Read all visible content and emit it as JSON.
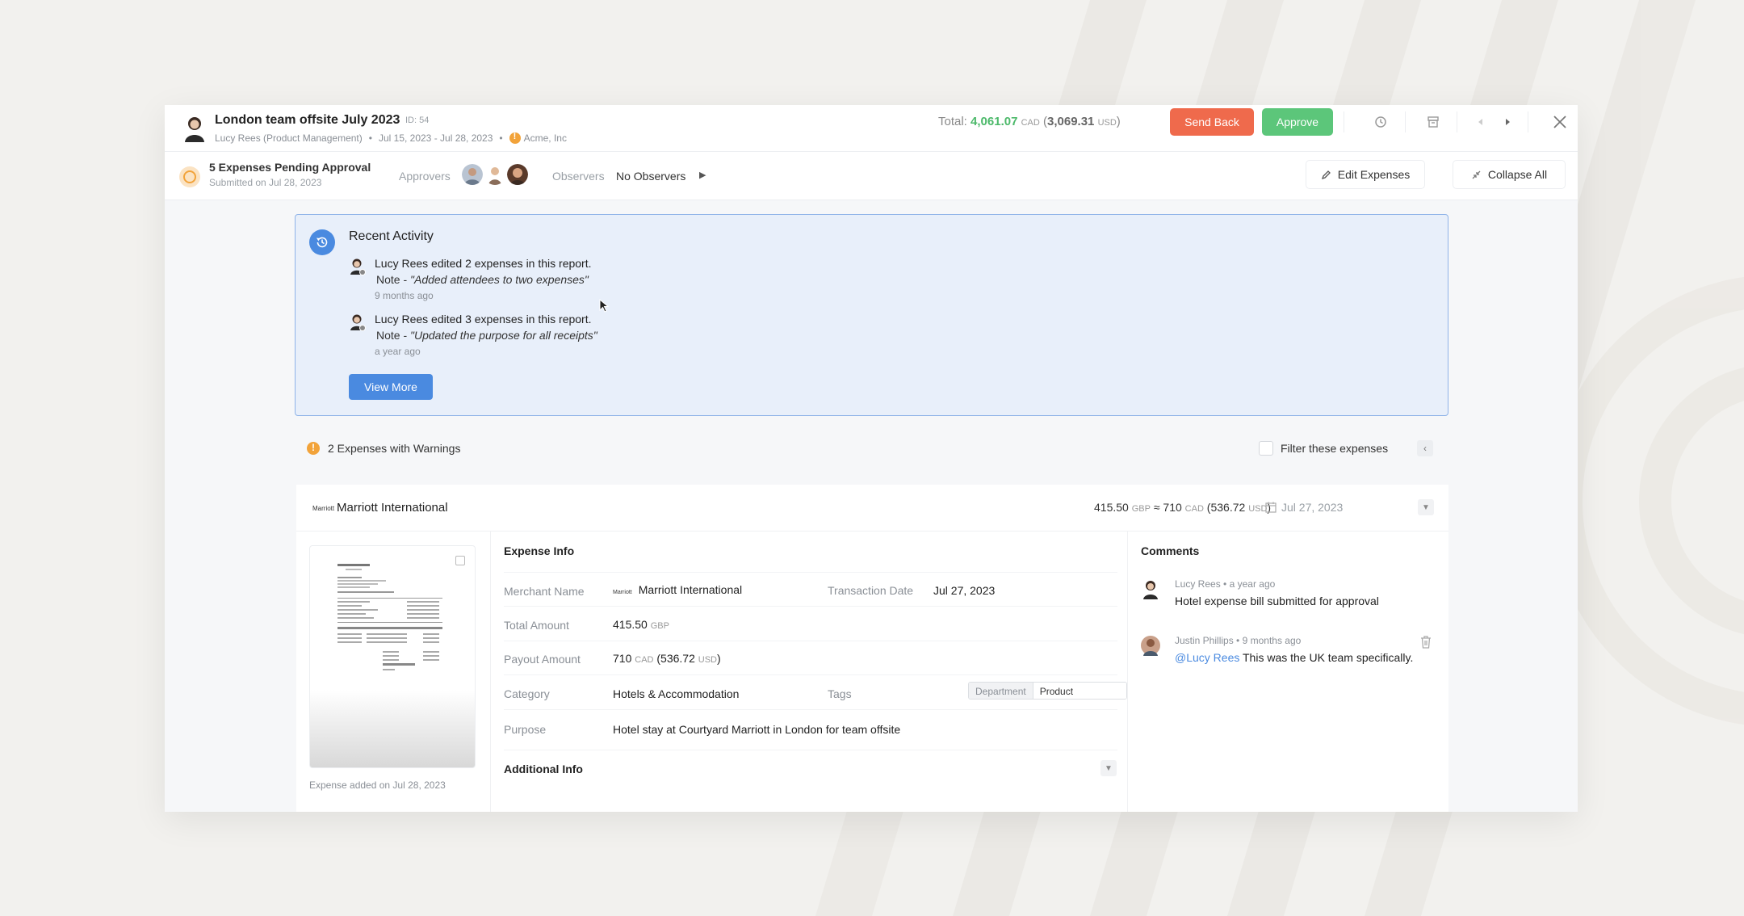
{
  "header": {
    "title": "London team offsite July 2023",
    "id_label": "ID: 54",
    "submitter": "Lucy Rees (Product Management)",
    "date_range": "Jul 15, 2023 - Jul 28, 2023",
    "organization": "Acme, Inc",
    "total_label": "Total:",
    "total_amount": "4,061.07",
    "total_currency": "CAD",
    "total_usd_amount": "3,069.31",
    "total_usd_currency": "USD",
    "send_back_label": "Send Back",
    "approve_label": "Approve"
  },
  "subheader": {
    "pending_title": "5 Expenses Pending Approval",
    "submitted_on": "Submitted on Jul 28, 2023",
    "approvers_label": "Approvers",
    "observers_label": "Observers",
    "observers_value": "No Observers",
    "edit_label": "Edit Expenses",
    "collapse_label": "Collapse All"
  },
  "activity": {
    "title": "Recent Activity",
    "items": [
      {
        "text": "Lucy Rees edited 2 expenses in this report.",
        "note_prefix": "Note - ",
        "note": "\"Added attendees to two expenses\"",
        "time": "9 months ago"
      },
      {
        "text": "Lucy Rees edited 3 expenses in this report.",
        "note_prefix": "Note - ",
        "note": "\"Updated the purpose for all receipts\"",
        "time": "a year ago"
      }
    ],
    "view_more_label": "View More"
  },
  "warnings": {
    "text": "2 Expenses with Warnings",
    "filter_label": "Filter these expenses"
  },
  "expense": {
    "logo_text": "Marriott",
    "merchant": "Marriott International",
    "amount_gbp": "415.50",
    "currency_gbp": "GBP",
    "approx": "≈",
    "amount_cad": "710",
    "currency_cad": "CAD",
    "amount_usd": "536.72",
    "currency_usd": "USD",
    "date": "Jul 27, 2023",
    "added_on": "Expense added on Jul 28, 2023",
    "info_title": "Expense Info",
    "labels": {
      "merchant_name": "Merchant Name",
      "transaction_date": "Transaction Date",
      "total_amount": "Total Amount",
      "payout_amount": "Payout Amount",
      "category": "Category",
      "tags": "Tags",
      "purpose": "Purpose"
    },
    "values": {
      "merchant_name": "Marriott International",
      "transaction_date": "Jul 27, 2023",
      "total_amount": "415.50",
      "total_currency": "GBP",
      "payout_amount": "710",
      "payout_currency": "CAD",
      "payout_usd": "536.72",
      "payout_usd_currency": "USD",
      "category": "Hotels & Accommodation",
      "tag_key": "Department",
      "tag_value": "Product Managem...",
      "purpose": "Hotel stay at Courtyard Marriott in London for team offsite"
    },
    "additional_info_title": "Additional Info"
  },
  "comments": {
    "title": "Comments",
    "items": [
      {
        "author": "Lucy Rees",
        "time": "a year ago",
        "text": "Hotel expense bill submitted for approval"
      },
      {
        "author": "Justin Phillips",
        "time": "9 months ago",
        "mention": "@Lucy Rees",
        "text": " This was the UK team specifically."
      }
    ]
  },
  "colors": {
    "send_back": "#ef6a4c",
    "approve": "#5cc67a",
    "total_amount": "#4cb96a",
    "activity_bg": "#e8effa",
    "activity_border": "#8fb3e8",
    "primary_blue": "#4a8ae0",
    "warning": "#f2a33a"
  }
}
